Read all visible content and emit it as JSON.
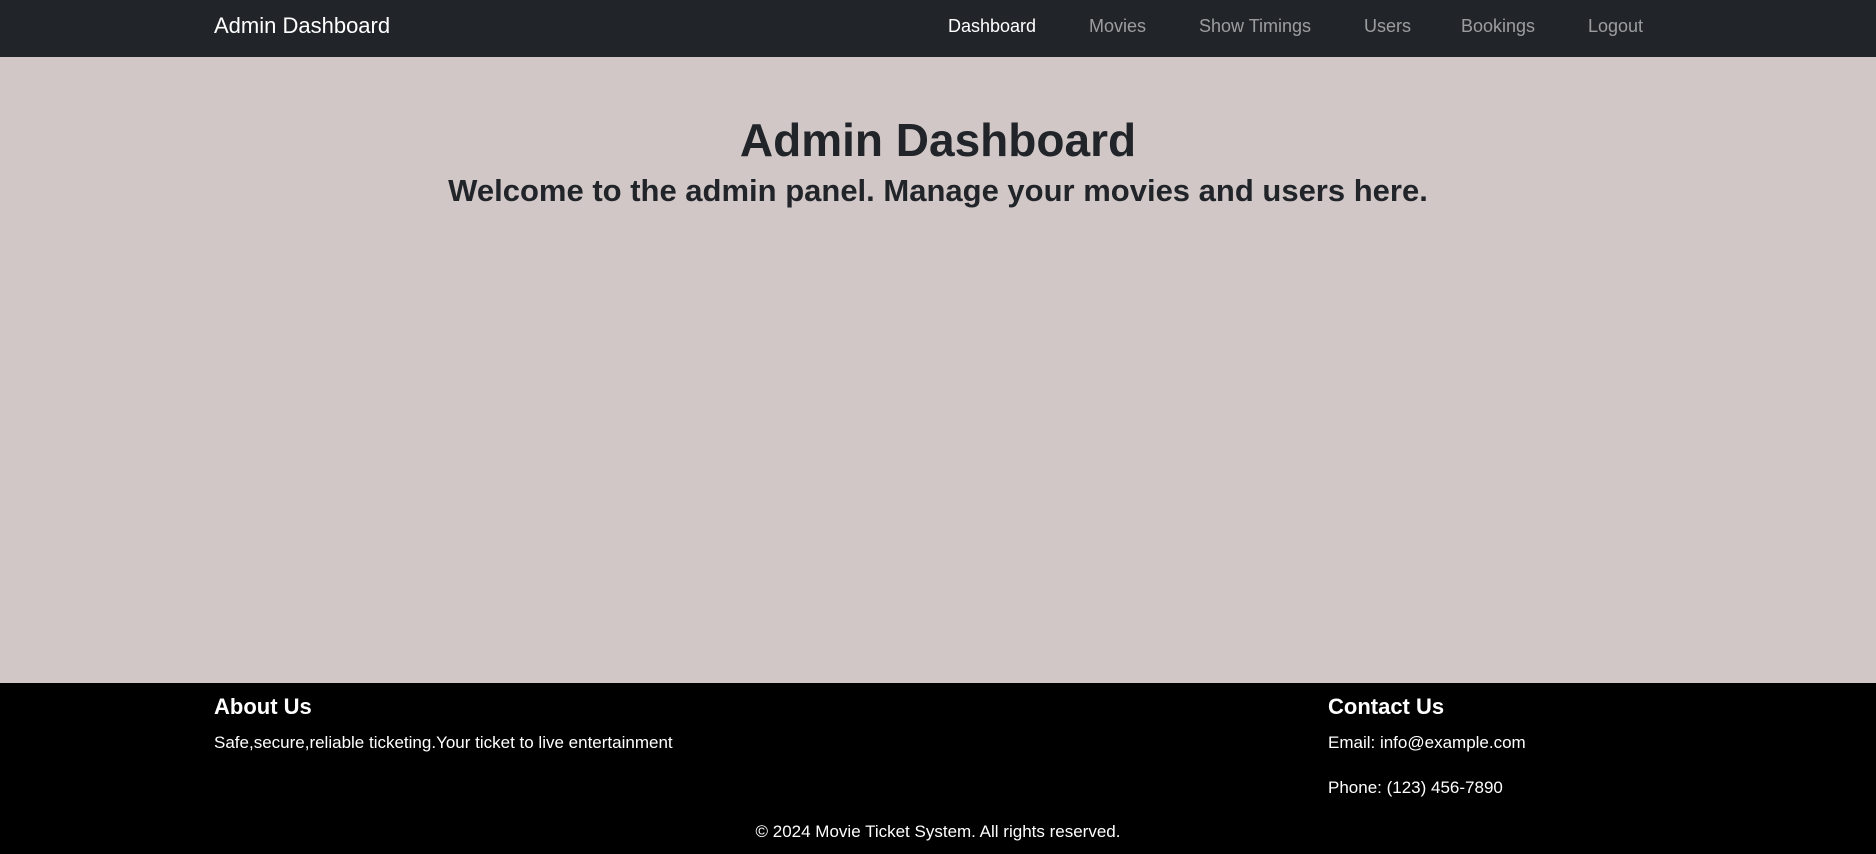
{
  "navbar": {
    "brand": "Admin Dashboard",
    "links": [
      {
        "label": "Dashboard",
        "active": true
      },
      {
        "label": "Movies",
        "active": false
      },
      {
        "label": "Show Timings",
        "active": false
      },
      {
        "label": "Users",
        "active": false
      },
      {
        "label": "Bookings",
        "active": false
      },
      {
        "label": "Logout",
        "active": false
      }
    ]
  },
  "main": {
    "title": "Admin Dashboard",
    "subtitle": "Welcome to the admin panel. Manage your movies and users here."
  },
  "footer": {
    "about": {
      "title": "About Us",
      "text": "Safe,secure,reliable ticketing.Your ticket to live entertainment"
    },
    "contact": {
      "title": "Contact Us",
      "email": "Email: info@example.com",
      "phone": "Phone: (123) 456-7890"
    },
    "copyright": "© 2024 Movie Ticket System. All rights reserved."
  },
  "colors": {
    "navbar_bg": "#212529",
    "page_bg": "#d2c7c7",
    "footer_bg": "#000000",
    "nav_active": "#ffffff",
    "nav_inactive": "rgba(255,255,255,0.55)"
  }
}
